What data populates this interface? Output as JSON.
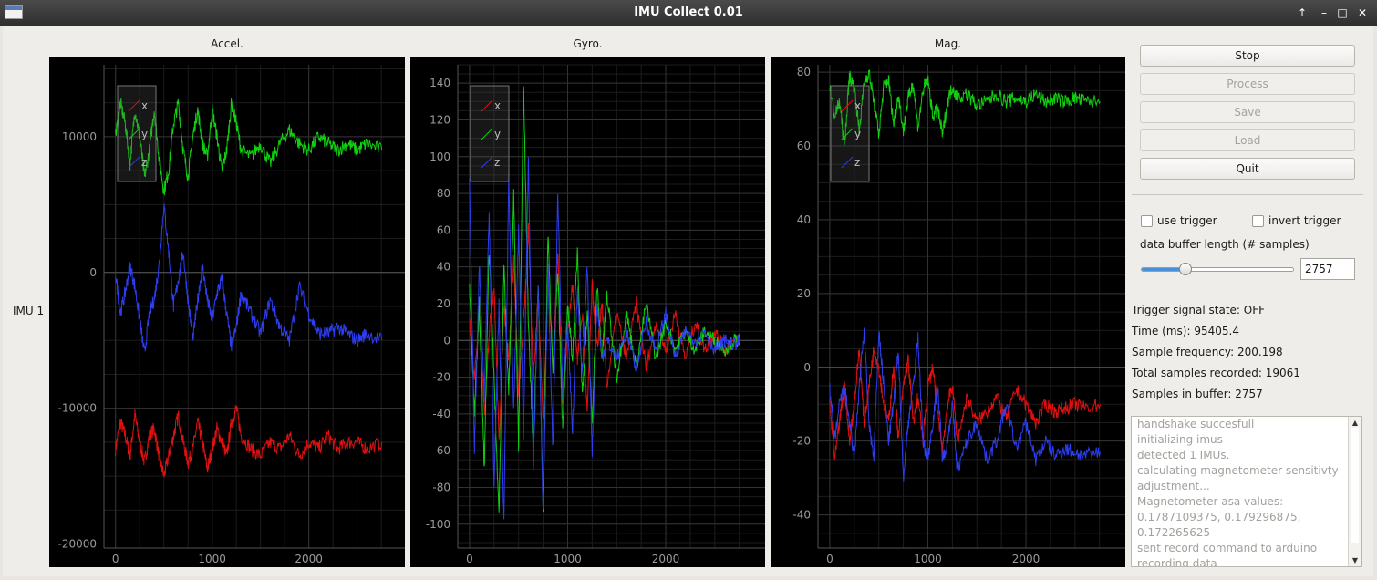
{
  "window": {
    "title": "IMU Collect 0.01",
    "controls": [
      "↑",
      "–",
      "□",
      "✕"
    ]
  },
  "row_label": "IMU 1",
  "buttons": {
    "stop": "Stop",
    "process": "Process",
    "save": "Save",
    "load": "Load",
    "quit": "Quit"
  },
  "options": {
    "use_trigger": "use trigger",
    "invert_trigger": "invert trigger",
    "buffer_label": "data buffer length (# samples)",
    "buffer_value": "2757",
    "buffer_fraction": 0.29
  },
  "status": {
    "trigger": "Trigger signal state: OFF",
    "time": "Time (ms): 95405.4",
    "frequency": "Sample frequency: 200.198",
    "total": "Total samples recorded: 19061",
    "buffer": "Samples in buffer: 2757"
  },
  "log": [
    "handshake succesfull",
    "initializing imus",
    "detected 1 IMUs.",
    "calculating magnetometer sensitivty",
    "adjustment...",
    "Magnetometer asa values:",
    "0.1787109375, 0.179296875,",
    "0.172265625",
    "sent record command to arduino",
    "recording data"
  ],
  "colors": {
    "x": "#e01010",
    "y": "#10d010",
    "z": "#2d3df0",
    "grid": "#2a2a2a",
    "zero": "#5a5a5a"
  },
  "chart_data": [
    {
      "type": "line",
      "title": "Accel.",
      "xlim": [
        -120,
        2900
      ],
      "ylim": [
        -20300,
        15300
      ],
      "x_ticks": [
        0,
        1000,
        2000
      ],
      "y_ticks": [
        10000,
        0,
        -10000,
        -20000
      ],
      "legend": [
        "x",
        "y",
        "z"
      ],
      "series": [
        {
          "name": "x",
          "color": "#e01010",
          "x": [
            0,
            50,
            100,
            150,
            200,
            250,
            300,
            350,
            400,
            450,
            500,
            550,
            600,
            650,
            700,
            750,
            800,
            850,
            900,
            950,
            1000,
            1050,
            1100,
            1150,
            1200,
            1250,
            1300,
            1400,
            1500,
            1600,
            1700,
            1800,
            1900,
            2000,
            2100,
            2200,
            2300,
            2400,
            2500,
            2600,
            2757
          ],
          "y": [
            -13000,
            -11000,
            -12000,
            -13500,
            -10500,
            -12500,
            -14000,
            -12000,
            -11500,
            -13500,
            -15000,
            -13500,
            -12000,
            -10500,
            -12500,
            -14000,
            -13000,
            -11000,
            -12500,
            -14500,
            -13000,
            -11500,
            -12500,
            -13500,
            -11000,
            -10000,
            -12000,
            -13000,
            -13500,
            -12500,
            -13000,
            -12000,
            -13500,
            -12500,
            -13000,
            -12000,
            -13000,
            -12500,
            -12500,
            -13000,
            -12500
          ]
        },
        {
          "name": "y",
          "color": "#10d010",
          "x": [
            0,
            50,
            100,
            150,
            200,
            250,
            300,
            350,
            400,
            450,
            500,
            550,
            600,
            650,
            700,
            750,
            800,
            850,
            900,
            950,
            1000,
            1050,
            1100,
            1150,
            1200,
            1250,
            1300,
            1400,
            1500,
            1600,
            1700,
            1800,
            1900,
            2000,
            2100,
            2200,
            2300,
            2400,
            2500,
            2600,
            2757
          ],
          "y": [
            10000,
            12500,
            11000,
            8000,
            12000,
            10000,
            7000,
            9000,
            12000,
            8500,
            6000,
            7500,
            11000,
            12500,
            9000,
            7000,
            10000,
            12000,
            9500,
            8500,
            12000,
            10000,
            7500,
            9000,
            12500,
            11000,
            9000,
            8500,
            9500,
            8000,
            9500,
            10500,
            9500,
            9000,
            10000,
            9500,
            9000,
            9500,
            9000,
            9500,
            9000
          ]
        },
        {
          "name": "z",
          "color": "#2d3df0",
          "x": [
            0,
            50,
            100,
            150,
            200,
            250,
            300,
            350,
            400,
            450,
            500,
            550,
            600,
            650,
            700,
            750,
            800,
            850,
            900,
            950,
            1000,
            1050,
            1100,
            1150,
            1200,
            1250,
            1300,
            1400,
            1500,
            1600,
            1700,
            1800,
            1900,
            2000,
            2100,
            2200,
            2300,
            2400,
            2500,
            2600,
            2757
          ],
          "y": [
            0,
            -3000,
            -1500,
            500,
            -1000,
            -3500,
            -6000,
            -3000,
            -2000,
            500,
            5000,
            1500,
            -2500,
            -500,
            1500,
            -2000,
            -5000,
            -2000,
            500,
            -2000,
            -3500,
            -1500,
            -500,
            -3000,
            -5500,
            -4000,
            -1500,
            -3000,
            -4500,
            -2000,
            -4000,
            -5000,
            -1000,
            -3000,
            -4500,
            -4500,
            -4000,
            -4500,
            -5000,
            -4500,
            -5000
          ]
        }
      ]
    },
    {
      "type": "line",
      "title": "Gyro.",
      "xlim": [
        -120,
        2920
      ],
      "ylim": [
        -113,
        150
      ],
      "x_ticks": [
        0,
        1000,
        2000
      ],
      "y_ticks": [
        140,
        120,
        100,
        80,
        60,
        40,
        20,
        0,
        -20,
        -40,
        -60,
        -80,
        -100
      ],
      "legend": [
        "x",
        "y",
        "z"
      ],
      "series": [
        {
          "name": "x",
          "color": "#e01010",
          "x": [
            0,
            50,
            100,
            150,
            200,
            250,
            300,
            350,
            400,
            450,
            500,
            550,
            600,
            650,
            700,
            750,
            800,
            850,
            900,
            950,
            1000,
            1050,
            1100,
            1150,
            1200,
            1250,
            1300,
            1350,
            1400,
            1500,
            1600,
            1700,
            1800,
            1900,
            2000,
            2100,
            2200,
            2300,
            2400,
            2500,
            2600,
            2700,
            2757
          ],
          "y": [
            10,
            -20,
            15,
            -40,
            5,
            30,
            -55,
            20,
            -10,
            45,
            -30,
            10,
            60,
            -20,
            25,
            -45,
            35,
            -15,
            50,
            -35,
            5,
            30,
            -10,
            15,
            -40,
            30,
            -5,
            20,
            -25,
            15,
            -10,
            20,
            -15,
            10,
            -5,
            15,
            -10,
            10,
            -5,
            5,
            -5,
            0,
            0
          ]
        },
        {
          "name": "y",
          "color": "#10d010",
          "x": [
            0,
            50,
            100,
            150,
            200,
            250,
            300,
            350,
            400,
            450,
            500,
            550,
            600,
            650,
            700,
            750,
            800,
            850,
            900,
            950,
            1000,
            1050,
            1100,
            1150,
            1200,
            1250,
            1300,
            1350,
            1400,
            1500,
            1600,
            1700,
            1800,
            1900,
            2000,
            2100,
            2200,
            2300,
            2400,
            2500,
            2600,
            2700,
            2757
          ],
          "y": [
            30,
            -40,
            20,
            -70,
            50,
            -20,
            -95,
            40,
            -30,
            80,
            -60,
            140,
            10,
            -60,
            30,
            -90,
            60,
            -20,
            40,
            -50,
            20,
            -10,
            50,
            -30,
            15,
            -45,
            30,
            -10,
            25,
            -20,
            15,
            -15,
            20,
            -10,
            10,
            -5,
            5,
            -5,
            5,
            0,
            -5,
            0,
            0
          ]
        },
        {
          "name": "z",
          "color": "#2d3df0",
          "x": [
            0,
            50,
            100,
            150,
            200,
            250,
            300,
            350,
            400,
            450,
            500,
            550,
            600,
            650,
            700,
            750,
            800,
            850,
            900,
            950,
            1000,
            1050,
            1100,
            1150,
            1200,
            1250,
            1300,
            1350,
            1400,
            1500,
            1600,
            1700,
            1800,
            1900,
            2000,
            2100,
            2200,
            2300,
            2400,
            2500,
            2600,
            2700,
            2757
          ],
          "y": [
            85,
            -60,
            40,
            -30,
            70,
            -80,
            20,
            -100,
            90,
            -40,
            60,
            -50,
            100,
            -70,
            30,
            -95,
            40,
            -60,
            80,
            -30,
            10,
            -50,
            30,
            -20,
            40,
            -60,
            20,
            -10,
            0,
            -10,
            5,
            -15,
            10,
            -5,
            15,
            -10,
            5,
            0,
            5,
            -5,
            0,
            -2,
            0
          ]
        }
      ]
    },
    {
      "type": "line",
      "title": "Mag.",
      "xlim": [
        -120,
        2920
      ],
      "ylim": [
        -49,
        82
      ],
      "x_ticks": [
        0,
        1000,
        2000
      ],
      "y_ticks": [
        80,
        60,
        40,
        20,
        0,
        -20,
        -40
      ],
      "legend": [
        "x",
        "y",
        "z"
      ],
      "series": [
        {
          "name": "x",
          "color": "#e01010",
          "x": [
            0,
            50,
            100,
            150,
            200,
            250,
            300,
            350,
            400,
            450,
            500,
            550,
            600,
            650,
            700,
            750,
            800,
            850,
            900,
            950,
            1000,
            1050,
            1100,
            1150,
            1200,
            1250,
            1300,
            1400,
            1500,
            1600,
            1700,
            1800,
            1900,
            2000,
            2100,
            2200,
            2300,
            2400,
            2500,
            2600,
            2757
          ],
          "y": [
            -10,
            -25,
            -15,
            -5,
            -20,
            -10,
            5,
            -15,
            -5,
            5,
            0,
            -10,
            -15,
            0,
            -20,
            -5,
            2,
            -15,
            -8,
            -20,
            -5,
            0,
            -12,
            -22,
            -10,
            -5,
            -20,
            -8,
            -15,
            -12,
            -8,
            -14,
            -6,
            -10,
            -15,
            -10,
            -12,
            -11,
            -10,
            -11,
            -10
          ]
        },
        {
          "name": "y",
          "color": "#10d010",
          "x": [
            0,
            50,
            100,
            150,
            200,
            250,
            300,
            350,
            400,
            450,
            500,
            550,
            600,
            650,
            700,
            750,
            800,
            850,
            900,
            950,
            1000,
            1050,
            1100,
            1150,
            1200,
            1250,
            1300,
            1400,
            1500,
            1600,
            1700,
            1800,
            1900,
            2000,
            2100,
            2200,
            2300,
            2400,
            2500,
            2600,
            2757
          ],
          "y": [
            76,
            68,
            72,
            60,
            79,
            76,
            64,
            77,
            80,
            72,
            63,
            76,
            78,
            66,
            74,
            64,
            73,
            77,
            65,
            75,
            78,
            68,
            70,
            63,
            72,
            76,
            73,
            74,
            71,
            72,
            74,
            72,
            73,
            72,
            74,
            72,
            73,
            72,
            73,
            72,
            72
          ]
        },
        {
          "name": "z",
          "color": "#2d3df0",
          "x": [
            0,
            50,
            100,
            150,
            200,
            250,
            300,
            350,
            400,
            450,
            500,
            550,
            600,
            650,
            700,
            750,
            800,
            850,
            900,
            950,
            1000,
            1050,
            1100,
            1150,
            1200,
            1250,
            1300,
            1400,
            1500,
            1600,
            1700,
            1800,
            1900,
            2000,
            2100,
            2200,
            2300,
            2400,
            2500,
            2600,
            2757
          ],
          "y": [
            -5,
            -20,
            -10,
            -5,
            -15,
            -25,
            -5,
            10,
            -15,
            -25,
            10,
            -5,
            -20,
            -10,
            5,
            -30,
            -15,
            -5,
            8,
            -20,
            -25,
            -15,
            -5,
            -25,
            -20,
            -10,
            -28,
            -20,
            -15,
            -25,
            -20,
            -10,
            -22,
            -15,
            -25,
            -20,
            -24,
            -22,
            -23,
            -24,
            -23
          ]
        }
      ]
    }
  ]
}
